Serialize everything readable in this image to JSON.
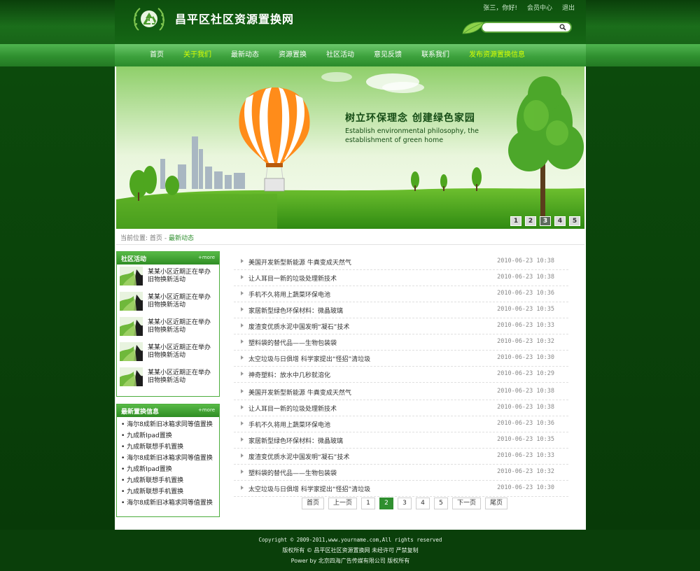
{
  "site": {
    "title": "昌平区社区资源置换网"
  },
  "topbar": {
    "user": "张三，你好!",
    "member_center": "会员中心",
    "logout": "退出"
  },
  "search": {
    "placeholder": ""
  },
  "nav": {
    "items": [
      "首页",
      "关于我们",
      "最新动态",
      "资源置换",
      "社区活动",
      "意见反馈",
      "联系我们",
      "发布资源置换信息"
    ],
    "active_index": 1
  },
  "banner": {
    "headline": "树立环保理念 创建绿色家园",
    "subline": "Establish environmental philosophy, the establishment of green home",
    "slides": [
      "1",
      "2",
      "3",
      "4",
      "5"
    ],
    "active_slide": 3
  },
  "breadcrumb": {
    "prefix": "当前位置:",
    "home": "首页",
    "sep": "-",
    "current": "最新动态"
  },
  "sidebar": {
    "activities": {
      "title": "社区活动",
      "more": "+more",
      "items": [
        "某某小区近期正在举办旧物换新活动",
        "某某小区近期正在举办旧物换新活动",
        "某某小区近期正在举办旧物换新活动",
        "某某小区近期正在举办旧物换新活动",
        "某某小区近期正在举办旧物换新活动"
      ]
    },
    "exchange": {
      "title": "最新置换信息",
      "more": "+more",
      "items": [
        "海尔8成新旧冰箱求同等值置换",
        "九成新Ipad置换",
        "九成新联想手机置换",
        "海尔8成新旧冰箱求同等值置换",
        "九成新Ipad置换",
        "九成新联想手机置换",
        "九成新联想手机置换",
        "海尔8成新旧冰箱求同等值置换"
      ]
    }
  },
  "news": {
    "rows": [
      {
        "title": "美国开发新型新能源 牛粪变成天然气",
        "date": "2010-06-23 10:38"
      },
      {
        "title": "让人耳目一新的垃圾处理新技术",
        "date": "2010-06-23 10:38"
      },
      {
        "title": "手机不久将用上蔬菜环保电池",
        "date": "2010-06-23 10:36"
      },
      {
        "title": "家居新型绿色环保材料：微晶玻璃",
        "date": "2010-06-23 10:35"
      },
      {
        "title": "废渣变优质水泥中国发明“凝石”技术",
        "date": "2010-06-23 10:33"
      },
      {
        "title": "塑料袋的替代品——生物包装袋",
        "date": "2010-06-23 10:32"
      },
      {
        "title": "太空垃圾与日俱增 科学家提出“怪招”清垃圾",
        "date": "2010-06-23 10:30"
      },
      {
        "title": "神奇塑料：放水中几秒就溶化",
        "date": "2010-06-23 10:29"
      },
      {
        "title": "美国开发新型新能源 牛粪变成天然气",
        "date": "2010-06-23 10:38"
      },
      {
        "title": "让人耳目一新的垃圾处理新技术",
        "date": "2010-06-23 10:38"
      },
      {
        "title": "手机不久将用上蔬菜环保电池",
        "date": "2010-06-23 10:36"
      },
      {
        "title": "家居新型绿色环保材料：微晶玻璃",
        "date": "2010-06-23 10:35"
      },
      {
        "title": "废渣变优质水泥中国发明“凝石”技术",
        "date": "2010-06-23 10:33"
      },
      {
        "title": "塑料袋的替代品——生物包装袋",
        "date": "2010-06-23 10:32"
      },
      {
        "title": "太空垃圾与日俱增 科学家提出“怪招”清垃圾",
        "date": "2010-06-23 10:30"
      }
    ]
  },
  "pager": {
    "first": "首页",
    "prev": "上一页",
    "pages": [
      "1",
      "2",
      "3",
      "4",
      "5"
    ],
    "active_page": "2",
    "next": "下一页",
    "last": "尾页"
  },
  "footer": {
    "copyright": "Copyright © 2009-2011,www.yourname.com,All rights reserved",
    "rights": "版权所有 © 昌平区社区资源置换网  未经许可 严禁复制",
    "power": "Power by  北京四海广告传媒有限公司  版权所有"
  },
  "colors": {
    "brand_green": "#2f8f2f",
    "nav_active": "#d9ff00",
    "dark_bg": "#0a3f0a"
  }
}
